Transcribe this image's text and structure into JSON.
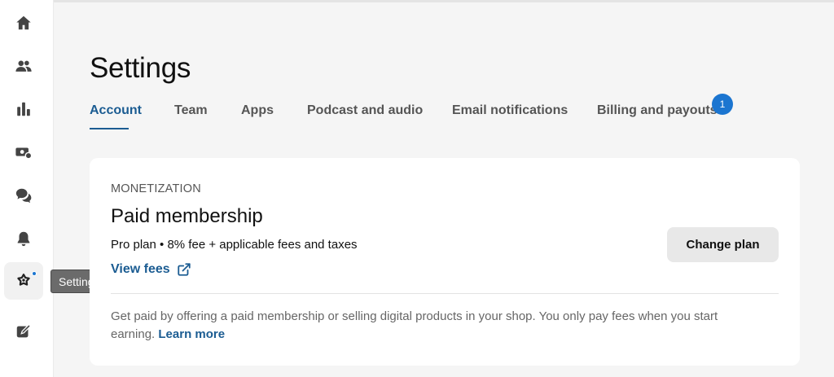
{
  "sidebar": {
    "items": [
      {
        "icon": "home-icon"
      },
      {
        "icon": "people-icon"
      },
      {
        "icon": "bar-chart-icon"
      },
      {
        "icon": "money-icon"
      },
      {
        "icon": "chat-bubbles-icon"
      },
      {
        "icon": "bell-icon"
      },
      {
        "icon": "settings-gear-icon"
      },
      {
        "icon": "compose-icon"
      }
    ],
    "tooltip": "Settings"
  },
  "page": {
    "title": "Settings"
  },
  "tabs": [
    {
      "label": "Account",
      "active": true
    },
    {
      "label": "Team"
    },
    {
      "label": "Apps"
    },
    {
      "label": "Podcast and audio"
    },
    {
      "label": "Email notifications"
    },
    {
      "label": "Billing and payouts",
      "count": "1"
    }
  ],
  "card": {
    "eyebrow": "MONETIZATION",
    "title": "Paid membership",
    "plan_line": "Pro plan • 8% fee + applicable fees and taxes",
    "view_fees": "View fees",
    "change_plan": "Change plan",
    "description": "Get paid by offering a paid membership or selling digital products in your shop. You only pay fees when you start earning.",
    "learn_more": "Learn more"
  },
  "colors": {
    "accent": "#1b5c92",
    "badge": "#1b75d0",
    "icon": "#444444"
  }
}
